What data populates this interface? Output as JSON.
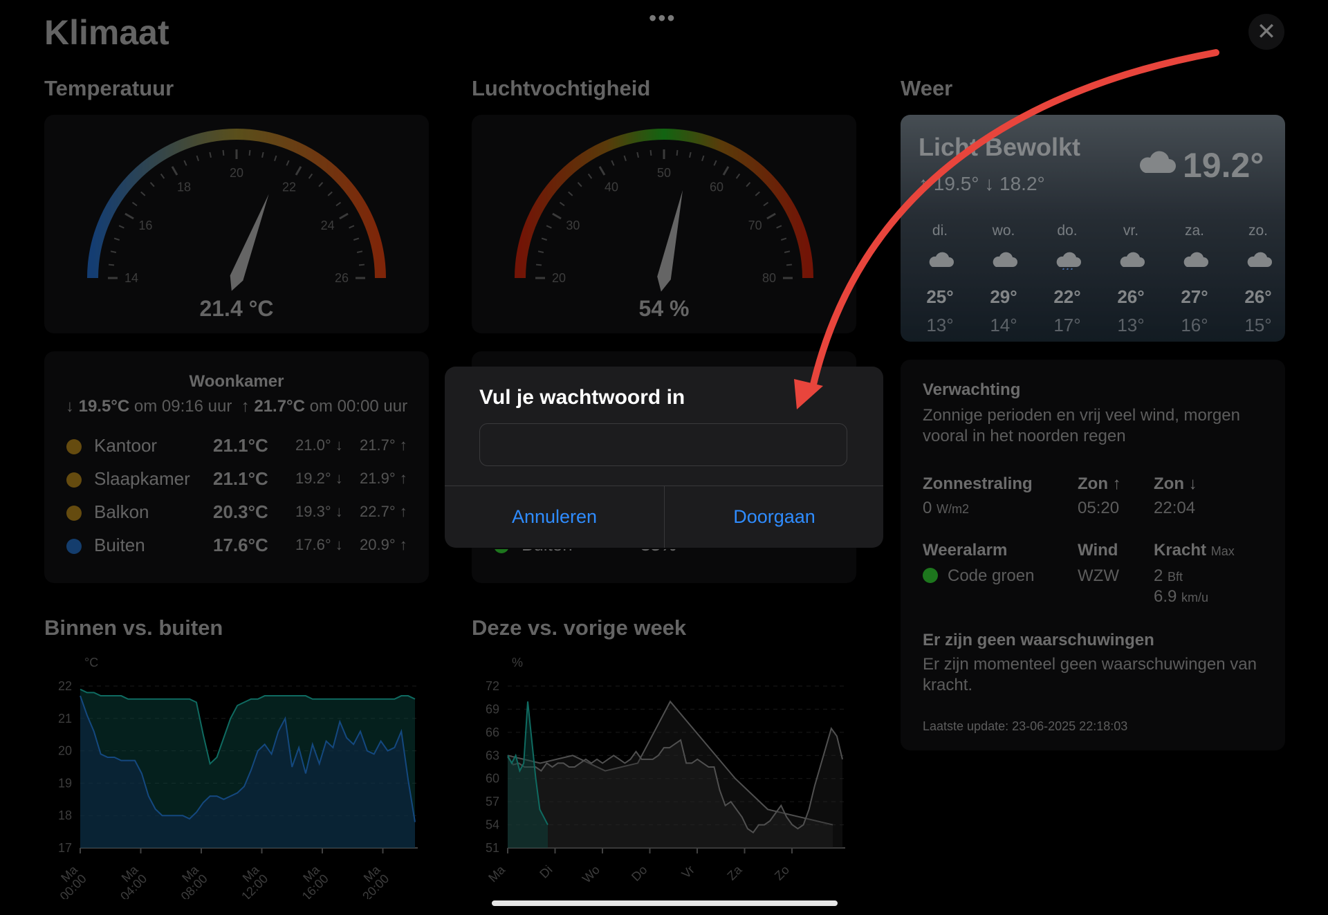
{
  "app": {
    "title": "Klimaat"
  },
  "temperature": {
    "title": "Temperatuur",
    "value": "21.4 °C",
    "gauge": {
      "min": 14,
      "max": 26,
      "value": 21.4,
      "labels": [
        "14",
        "16",
        "18",
        "20",
        "22",
        "24",
        "26"
      ]
    },
    "card": {
      "title": "Woonkamer",
      "min_text": "↓",
      "min_value": "19.5°C",
      "min_time": "om 09:16 uur",
      "max_text": "↑",
      "max_value": "21.7°C",
      "max_time": "om 00:00 uur",
      "rooms": [
        {
          "name": "Kantoor",
          "current": "21.1°C",
          "min": "21.0° ↓",
          "max": "21.7° ↑",
          "color": "#9c7418"
        },
        {
          "name": "Slaapkamer",
          "current": "21.1°C",
          "min": "19.2° ↓",
          "max": "21.9° ↑",
          "color": "#9c7418"
        },
        {
          "name": "Balkon",
          "current": "20.3°C",
          "min": "19.3° ↓",
          "max": "22.7° ↑",
          "color": "#9c7418"
        },
        {
          "name": "Buiten",
          "current": "17.6°C",
          "min": "17.6° ↓",
          "max": "20.9° ↑",
          "color": "#1f5fa8"
        }
      ]
    }
  },
  "humidity": {
    "title": "Luchtvochtigheid",
    "value": "54 %",
    "gauge": {
      "min": 20,
      "max": 80,
      "value": 54,
      "labels": [
        "20",
        "30",
        "40",
        "50",
        "60",
        "70",
        "80"
      ]
    },
    "partial_row": {
      "name": "Buiten",
      "current": "83%"
    }
  },
  "weather": {
    "title": "Weer",
    "condition": "Licht Bewolkt",
    "high_low": "↑ 19.5° ↓ 18.2°",
    "temp": "19.2°",
    "forecast": [
      {
        "day": "di.",
        "high": "25°",
        "low": "13°",
        "icon": "cloud"
      },
      {
        "day": "wo.",
        "high": "29°",
        "low": "14°",
        "icon": "cloud"
      },
      {
        "day": "do.",
        "high": "22°",
        "low": "17°",
        "icon": "rain"
      },
      {
        "day": "vr.",
        "high": "26°",
        "low": "13°",
        "icon": "cloud"
      },
      {
        "day": "za.",
        "high": "27°",
        "low": "16°",
        "icon": "cloud"
      },
      {
        "day": "zo.",
        "high": "26°",
        "low": "15°",
        "icon": "cloud"
      }
    ]
  },
  "forecast_card": {
    "expectation_label": "Verwachting",
    "expectation_text": "Zonnige perioden en vrij veel wind, morgen vooral in het noorden regen",
    "radiation_label": "Zonnestraling",
    "radiation_value": "0",
    "radiation_unit": "W/m2",
    "sunrise_label": "Zon ↑",
    "sunrise_value": "05:20",
    "sunset_label": "Zon ↓",
    "sunset_value": "22:04",
    "alarm_label": "Weeralarm",
    "alarm_value": "Code groen",
    "alarm_color": "#2db52d",
    "wind_label": "Wind",
    "wind_value": "WZW",
    "force_label": "Kracht",
    "force_max": "Max",
    "force_bft": "2",
    "force_bft_unit": "Bft",
    "force_kmh": "6.9",
    "force_kmh_unit": "km/u",
    "warn_title": "Er zijn geen waarschuwingen",
    "warn_text": "Er zijn momenteel geen waarschuwingen van kracht.",
    "update": "Laatste update: 23-06-2025 22:18:03"
  },
  "chart_data": [
    {
      "type": "area",
      "title": "Binnen vs. buiten",
      "ylabel": "°C",
      "ylim": [
        17,
        22
      ],
      "yticks": [
        "22",
        "21",
        "20",
        "19",
        "18",
        "17"
      ],
      "xticks": [
        [
          "Ma",
          "00:00"
        ],
        [
          "Ma",
          "04:00"
        ],
        [
          "Ma",
          "08:00"
        ],
        [
          "Ma",
          "12:00"
        ],
        [
          "Ma",
          "16:00"
        ],
        [
          "Ma",
          "20:00"
        ]
      ],
      "series": [
        {
          "values": [
            21.9,
            21.8,
            21.8,
            21.7,
            21.7,
            21.7,
            21.7,
            21.6,
            21.6,
            21.6,
            21.6,
            21.6,
            21.6,
            21.6,
            21.6,
            21.6,
            21.6,
            21.5,
            20.5,
            19.6,
            19.8,
            20.4,
            21.0,
            21.4,
            21.5,
            21.6,
            21.6,
            21.7,
            21.7,
            21.7,
            21.7,
            21.7,
            21.7,
            21.7,
            21.6,
            21.6,
            21.6,
            21.6,
            21.6,
            21.6,
            21.6,
            21.6,
            21.6,
            21.6,
            21.6,
            21.6,
            21.6,
            21.7,
            21.7,
            21.6
          ]
        },
        {
          "values": [
            21.7,
            21.1,
            20.6,
            19.9,
            19.8,
            19.8,
            19.7,
            19.7,
            19.7,
            19.3,
            18.6,
            18.2,
            18.0,
            18.0,
            18.0,
            18.0,
            17.9,
            18.1,
            18.4,
            18.6,
            18.6,
            18.5,
            18.6,
            18.7,
            18.9,
            19.4,
            20.0,
            20.2,
            19.9,
            20.6,
            21.0,
            19.5,
            20.1,
            19.3,
            20.2,
            19.6,
            20.3,
            20.1,
            20.9,
            20.4,
            20.2,
            20.6,
            20.0,
            19.9,
            20.3,
            20.0,
            20.1,
            20.6,
            19.1,
            17.8
          ]
        }
      ]
    },
    {
      "type": "area",
      "title": "Deze vs. vorige week",
      "ylabel": "%",
      "ylim": [
        51,
        72
      ],
      "yticks": [
        "72",
        "69",
        "66",
        "63",
        "60",
        "57",
        "54",
        "51"
      ],
      "xticks": [
        "Ma",
        "Di",
        "Wo",
        "Do",
        "Vr",
        "Za",
        "Zo"
      ],
      "series": [
        {
          "values": [
            63,
            62,
            63,
            61,
            62,
            70,
            65,
            60,
            56,
            55,
            54
          ]
        },
        {
          "values": [
            62.8,
            61.8,
            62.0,
            61.5,
            61.5,
            61.5,
            61.0,
            62.0,
            61.5,
            62.0,
            62.0,
            61.5,
            61.5,
            62.0,
            62.5,
            62.0,
            62.5,
            62.0,
            62.5,
            63.0,
            62.5,
            62.0,
            62.5,
            63.5,
            62.5,
            62.5,
            62.5,
            63.0,
            64.0,
            64.0,
            64.5,
            65.0,
            62.0,
            62.0,
            62.5,
            62.0,
            61.5,
            61.5,
            58.5,
            56.5,
            57.0,
            56.0,
            55.0,
            53.5,
            53.0,
            54.0,
            54.0,
            54.5,
            55.5,
            56.5,
            55.0,
            54.0,
            53.5,
            54.0,
            56.0,
            59.0,
            61.5,
            64.0,
            66.5,
            65.5,
            62.5
          ]
        }
      ]
    }
  ],
  "dialog": {
    "title": "Vul je wachtwoord in",
    "input_value": "",
    "cancel": "Annuleren",
    "continue": "Doorgaan"
  }
}
